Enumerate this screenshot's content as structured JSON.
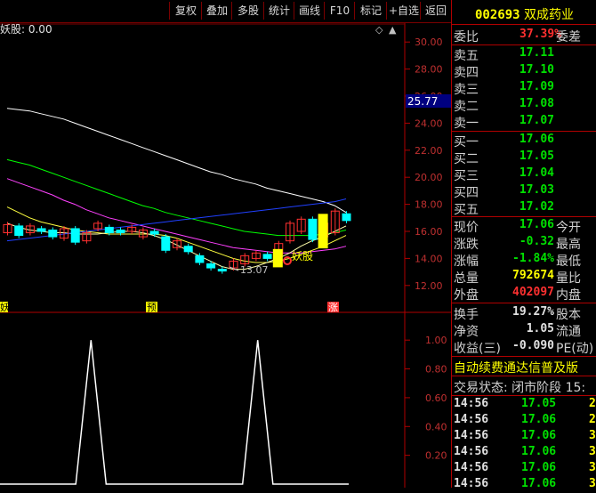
{
  "toolbar": {
    "buttons": [
      "复权",
      "叠加",
      "多股",
      "统计",
      "画线",
      "F10",
      "标记",
      "+自选",
      "返回"
    ]
  },
  "chart": {
    "indicator_label": "妖股: 0.00",
    "price_axis": [
      "30.00",
      "28.00",
      "26.00",
      "24.00",
      "22.00",
      "20.00",
      "18.00",
      "16.00",
      "14.00",
      "12.00"
    ],
    "current_price_tag": "25.77",
    "low_label": "13.07",
    "signal_label": "妖股",
    "bottom_markers": [
      "妖",
      "预",
      "涨"
    ],
    "sub_axis": [
      "1.00",
      "0.80",
      "0.60",
      "0.40",
      "0.20"
    ],
    "colors": {
      "up": "#ff3030",
      "down": "#00ffff",
      "signal": "#ffff00"
    }
  },
  "chart_data": {
    "type": "candlestick",
    "price_ylim": [
      11,
      31
    ],
    "candles": [
      {
        "o": 15.9,
        "c": 16.5
      },
      {
        "o": 16.4,
        "c": 15.7
      },
      {
        "o": 15.9,
        "c": 16.4
      },
      {
        "o": 16.2,
        "c": 16.0
      },
      {
        "o": 16.1,
        "c": 15.6
      },
      {
        "o": 15.5,
        "c": 16.2
      },
      {
        "o": 16.2,
        "c": 15.2
      },
      {
        "o": 15.3,
        "c": 15.9
      },
      {
        "o": 16.2,
        "c": 16.6
      },
      {
        "o": 16.3,
        "c": 15.9
      },
      {
        "o": 16.1,
        "c": 15.9
      },
      {
        "o": 16.0,
        "c": 16.3
      },
      {
        "o": 15.6,
        "c": 16.1
      },
      {
        "o": 16.0,
        "c": 15.8
      },
      {
        "o": 15.6,
        "c": 14.6
      },
      {
        "o": 14.8,
        "c": 15.3
      },
      {
        "o": 14.9,
        "c": 14.5
      },
      {
        "o": 14.2,
        "c": 13.7
      },
      {
        "o": 13.6,
        "c": 13.3
      },
      {
        "o": 13.2,
        "c": 13.1
      },
      {
        "o": 13.3,
        "c": 13.8
      },
      {
        "o": 13.6,
        "c": 14.2
      },
      {
        "o": 14.0,
        "c": 14.4
      },
      {
        "o": 14.3,
        "c": 14.0
      },
      {
        "o": 14.3,
        "c": 15.1
      },
      {
        "o": 15.3,
        "c": 16.6
      },
      {
        "o": 16.0,
        "c": 16.9
      },
      {
        "o": 16.9,
        "c": 15.4
      },
      {
        "o": 15.6,
        "c": 16.6
      },
      {
        "o": 15.9,
        "c": 17.5
      },
      {
        "o": 17.3,
        "c": 16.8
      }
    ],
    "ma_lines": [
      {
        "color": "#ffffff",
        "values": [
          25.1,
          25.0,
          24.9,
          24.7,
          24.5,
          24.3,
          24.0,
          23.7,
          23.4,
          23.1,
          22.8,
          22.5,
          22.2,
          21.9,
          21.6,
          21.3,
          21.0,
          20.7,
          20.4,
          20.2,
          19.9,
          19.7,
          19.5,
          19.2,
          19.0,
          18.8,
          18.6,
          18.4,
          18.2,
          17.9,
          17.4
        ]
      },
      {
        "color": "#00ff00",
        "values": [
          21.3,
          21.1,
          20.9,
          20.6,
          20.3,
          20.0,
          19.7,
          19.4,
          19.1,
          18.8,
          18.5,
          18.2,
          17.9,
          17.7,
          17.4,
          17.2,
          17.0,
          16.8,
          16.6,
          16.4,
          16.2,
          16.0,
          15.9,
          15.8,
          15.7,
          15.7,
          15.7,
          15.7,
          15.8,
          15.9,
          16.1
        ]
      },
      {
        "color": "#ff40ff",
        "values": [
          19.9,
          19.6,
          19.3,
          19.0,
          18.7,
          18.3,
          18.0,
          17.6,
          17.3,
          17.0,
          16.8,
          16.6,
          16.4,
          16.2,
          16.0,
          15.8,
          15.6,
          15.4,
          15.2,
          15.0,
          14.8,
          14.7,
          14.6,
          14.5,
          14.4,
          14.4,
          14.4,
          14.5,
          14.6,
          14.7,
          14.9
        ]
      },
      {
        "color": "#ffff40",
        "values": [
          17.8,
          17.4,
          17.0,
          16.7,
          16.5,
          16.3,
          16.1,
          16.0,
          15.9,
          15.8,
          15.8,
          15.8,
          15.8,
          15.8,
          15.7,
          15.5,
          15.2,
          14.9,
          14.6,
          14.3,
          14.0,
          13.8,
          13.7,
          13.7,
          13.8,
          14.0,
          14.3,
          14.6,
          14.9,
          15.3,
          15.7
        ]
      },
      {
        "color": "#ffffaa",
        "values": [
          16.6,
          16.3,
          16.1,
          16.0,
          15.9,
          15.9,
          15.8,
          15.8,
          15.8,
          15.9,
          16.0,
          16.0,
          15.9,
          15.7,
          15.4,
          15.0,
          14.6,
          14.2,
          13.8,
          13.4,
          13.2,
          13.2,
          13.4,
          13.7,
          14.0,
          14.4,
          14.9,
          15.3,
          15.6,
          16.0,
          16.4
        ]
      },
      {
        "color": "#2040ff",
        "values": [
          15.3,
          15.4,
          15.5,
          15.6,
          15.7,
          15.8,
          15.9,
          16.0,
          16.1,
          16.2,
          16.3,
          16.4,
          16.5,
          16.6,
          16.7,
          16.8,
          16.9,
          17.0,
          17.1,
          17.2,
          17.3,
          17.4,
          17.5,
          17.6,
          17.7,
          17.8,
          17.9,
          18.0,
          18.1,
          18.2,
          18.4
        ]
      }
    ],
    "sub_ylim": [
      0,
      1.1
    ],
    "sub_values": [
      0,
      0,
      0,
      0,
      0,
      0,
      1,
      0,
      0,
      0,
      0,
      0,
      0,
      0,
      0,
      0,
      0,
      1,
      0,
      0,
      0,
      0,
      0,
      0
    ]
  },
  "panel": {
    "code": "002693",
    "name": "双成药业",
    "weibi": {
      "label": "委比",
      "value": "37.39%",
      "label2": "委差"
    },
    "asks": [
      {
        "label": "卖五",
        "price": "17.11"
      },
      {
        "label": "卖四",
        "price": "17.10"
      },
      {
        "label": "卖三",
        "price": "17.09"
      },
      {
        "label": "卖二",
        "price": "17.08"
      },
      {
        "label": "卖一",
        "price": "17.07"
      }
    ],
    "bids": [
      {
        "label": "买一",
        "price": "17.06"
      },
      {
        "label": "买二",
        "price": "17.05"
      },
      {
        "label": "买三",
        "price": "17.04"
      },
      {
        "label": "买四",
        "price": "17.03"
      },
      {
        "label": "买五",
        "price": "17.02"
      }
    ],
    "stats": [
      {
        "label": "现价",
        "value": "17.06",
        "label2": "今开",
        "cls": "g"
      },
      {
        "label": "涨跌",
        "value": "-0.32",
        "label2": "最高",
        "cls": "g"
      },
      {
        "label": "涨幅",
        "value": "-1.84%",
        "label2": "最低",
        "cls": "g"
      },
      {
        "label": "总量",
        "value": "792674",
        "label2": "量比",
        "cls": "y"
      },
      {
        "label": "外盘",
        "value": "402097",
        "label2": "内盘",
        "cls": "r"
      }
    ],
    "fund": [
      {
        "label": "换手",
        "value": "19.27%",
        "label2": "股本"
      },
      {
        "label": "净资",
        "value": "1.05",
        "label2": "流通"
      },
      {
        "label": "收益(三)",
        "value": "-0.090",
        "label2": "PE(动)"
      }
    ],
    "notice": "自动续费通达信普及版",
    "status": "交易状态: 闭市阶段 15:",
    "ticks": [
      {
        "time": "14:56",
        "price": "17.05",
        "vol": "2"
      },
      {
        "time": "14:56",
        "price": "17.06",
        "vol": "2"
      },
      {
        "time": "14:56",
        "price": "17.06",
        "vol": "3"
      },
      {
        "time": "14:56",
        "price": "17.06",
        "vol": "3"
      },
      {
        "time": "14:56",
        "price": "17.06",
        "vol": "3"
      },
      {
        "time": "14:56",
        "price": "17.06",
        "vol": "3"
      }
    ]
  }
}
